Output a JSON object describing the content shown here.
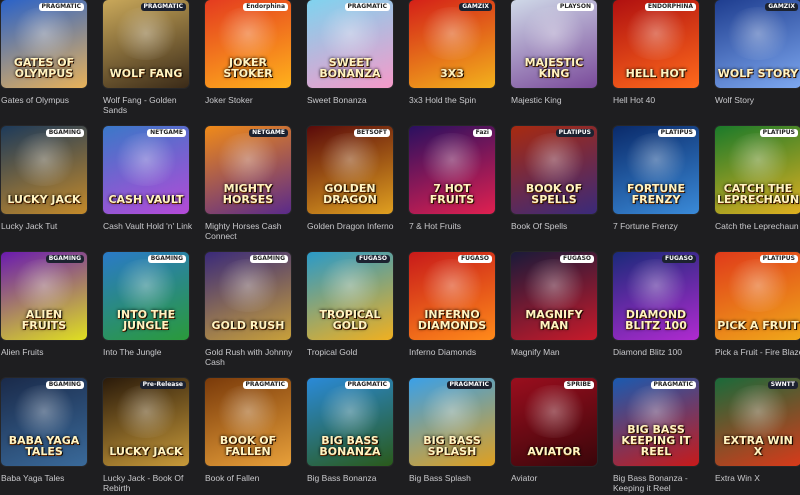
{
  "games": [
    {
      "title": "Gates of Olympus",
      "logo": "Gates of Olympus",
      "bg1": "#2a62c8",
      "bg2": "#e8b25a",
      "badge": "PRAGMATIC"
    },
    {
      "title": "Wolf Fang - Golden Sands",
      "logo": "Wolf Fang",
      "bg1": "#c9a85a",
      "bg2": "#3a2a18",
      "badge": "PRAGMATIC"
    },
    {
      "title": "Joker Stoker",
      "logo": "Joker Stoker",
      "bg1": "#e43b1f",
      "bg2": "#ffb21c",
      "badge": "Endorphina"
    },
    {
      "title": "Sweet Bonanza",
      "logo": "Sweet Bonanza",
      "bg1": "#7fd3ef",
      "bg2": "#f59ac9",
      "badge": "PRAGMATIC"
    },
    {
      "title": "3x3 Hold the Spin",
      "logo": "3x3",
      "bg1": "#d42018",
      "bg2": "#f3b21c",
      "badge": "GAMZIX"
    },
    {
      "title": "Majestic King",
      "logo": "Majestic King",
      "bg1": "#cfd9e8",
      "bg2": "#7a4a9a",
      "badge": "PLAYSON"
    },
    {
      "title": "Hell Hot 40",
      "logo": "Hell Hot",
      "bg1": "#b01010",
      "bg2": "#ff6a1c",
      "badge": "ENDORPHINA"
    },
    {
      "title": "Wolf Story",
      "logo": "Wolf Story",
      "bg1": "#1e3d8f",
      "bg2": "#7ea8f0",
      "badge": "GAMZIX"
    },
    {
      "title": "Lucky Jack Tut",
      "logo": "Lucky Jack",
      "bg1": "#1d3a5a",
      "bg2": "#c48a2a",
      "badge": "BGAMING"
    },
    {
      "title": "Cash Vault Hold 'n' Link",
      "logo": "Cash Vault",
      "bg1": "#3a78c8",
      "bg2": "#b54ad8",
      "badge": "NETGAME"
    },
    {
      "title": "Mighty Horses Cash Connect",
      "logo": "Mighty Horses",
      "bg1": "#f08a18",
      "bg2": "#5a2a8a",
      "badge": "NETGAME"
    },
    {
      "title": "Golden Dragon Inferno",
      "logo": "Golden Dragon",
      "bg1": "#5a0a0a",
      "bg2": "#e0a020",
      "badge": "BETSOFT"
    },
    {
      "title": "7 & Hot Fruits",
      "logo": "7 Hot Fruits",
      "bg1": "#2a1060",
      "bg2": "#e02050",
      "badge": "Fazi"
    },
    {
      "title": "Book Of Spells",
      "logo": "Book of Spells",
      "bg1": "#a82a10",
      "bg2": "#3a2a7a",
      "badge": "PLATIPUS"
    },
    {
      "title": "7 Fortune Frenzy",
      "logo": "Fortune Frenzy",
      "bg1": "#0a2a6a",
      "bg2": "#3a8ad8",
      "badge": "PLATIPUS"
    },
    {
      "title": "Catch the Leprechaun",
      "logo": "Catch the Leprechaun",
      "bg1": "#1a7a2a",
      "bg2": "#e0b020",
      "badge": "PLATIPUS"
    },
    {
      "title": "Alien Fruits",
      "logo": "Alien Fruits",
      "bg1": "#6a1ab0",
      "bg2": "#e0e020",
      "badge": "BGAMING"
    },
    {
      "title": "Into The Jungle",
      "logo": "Into the Jungle",
      "bg1": "#2a7ac8",
      "bg2": "#2a9a3a",
      "badge": "BGAMING"
    },
    {
      "title": "Gold Rush with Johnny Cash",
      "logo": "Gold Rush",
      "bg1": "#3a2a7a",
      "bg2": "#c8a03a",
      "badge": "BGAMING"
    },
    {
      "title": "Tropical Gold",
      "logo": "Tropical Gold",
      "bg1": "#2a9ac8",
      "bg2": "#f0b020",
      "badge": "FUGASO"
    },
    {
      "title": "Inferno Diamonds",
      "logo": "Inferno Diamonds",
      "bg1": "#c81a1a",
      "bg2": "#ff8a1a",
      "badge": "FUGASO"
    },
    {
      "title": "Magnify Man",
      "logo": "Magnify Man",
      "bg1": "#1a1a3a",
      "bg2": "#c81a2a",
      "badge": "FUGASO"
    },
    {
      "title": "Diamond Blitz 100",
      "logo": "Diamond Blitz 100",
      "bg1": "#1a2a7a",
      "bg2": "#b02ad0",
      "badge": "FUGASO"
    },
    {
      "title": "Pick a Fruit - Fire Blaze",
      "logo": "Pick a Fruit",
      "bg1": "#e03a1a",
      "bg2": "#f0a81a",
      "badge": "PLATIPUS"
    },
    {
      "title": "Baba Yaga Tales",
      "logo": "Baba Yaga Tales",
      "bg1": "#1a2a4a",
      "bg2": "#3a6a9a",
      "badge": "BGAMING"
    },
    {
      "title": "Lucky Jack - Book Of Rebirth",
      "logo": "Lucky Jack",
      "bg1": "#2a1a0a",
      "bg2": "#c89a3a",
      "badge": "Pre-Release"
    },
    {
      "title": "Book of Fallen",
      "logo": "Book of Fallen",
      "bg1": "#7a3a0a",
      "bg2": "#e8a03a",
      "badge": "PRAGMATIC"
    },
    {
      "title": "Big Bass Bonanza",
      "logo": "Big Bass Bonanza",
      "bg1": "#2a8ad8",
      "bg2": "#2a5a1a",
      "badge": "PRAGMATIC"
    },
    {
      "title": "Big Bass Splash",
      "logo": "Big Bass Splash",
      "bg1": "#3aa0e8",
      "bg2": "#e0a020",
      "badge": "PRAGMATIC"
    },
    {
      "title": "Aviator",
      "logo": "Aviator",
      "bg1": "#9a0e1e",
      "bg2": "#3a060a",
      "badge": "SPRIBE"
    },
    {
      "title": "Big Bass Bonanza - Keeping it Reel",
      "logo": "Big Bass Keeping it Reel",
      "bg1": "#1a5ab0",
      "bg2": "#c81a1a",
      "badge": "PRAGMATIC"
    },
    {
      "title": "Extra Win X",
      "logo": "Extra Win X",
      "bg1": "#1a6a3a",
      "bg2": "#d83a1a",
      "badge": "SWNTT"
    }
  ]
}
